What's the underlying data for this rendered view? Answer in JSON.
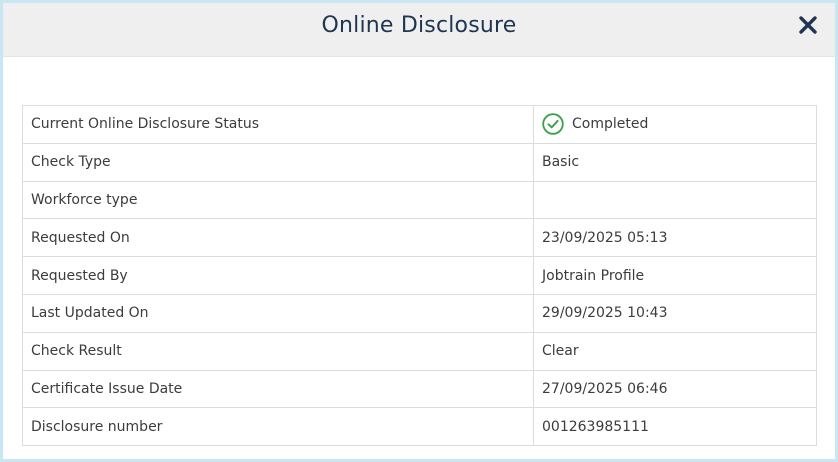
{
  "modal": {
    "title": "Online Disclosure",
    "close_icon": "close-icon"
  },
  "status": {
    "icon": "check-circle-icon",
    "icon_color": "#3aa04a"
  },
  "rows": [
    {
      "label": "Current Online Disclosure Status",
      "value": "Completed"
    },
    {
      "label": "Check Type",
      "value": "Basic"
    },
    {
      "label": "Workforce type",
      "value": ""
    },
    {
      "label": "Requested On",
      "value": "23/09/2025 05:13"
    },
    {
      "label": "Requested By",
      "value": "Jobtrain Profile"
    },
    {
      "label": "Last Updated On",
      "value": "29/09/2025 10:43"
    },
    {
      "label": "Check Result",
      "value": "Clear"
    },
    {
      "label": "Certificate Issue Date",
      "value": "27/09/2025 06:46"
    },
    {
      "label": "Disclosure number",
      "value": "001263985111"
    }
  ]
}
